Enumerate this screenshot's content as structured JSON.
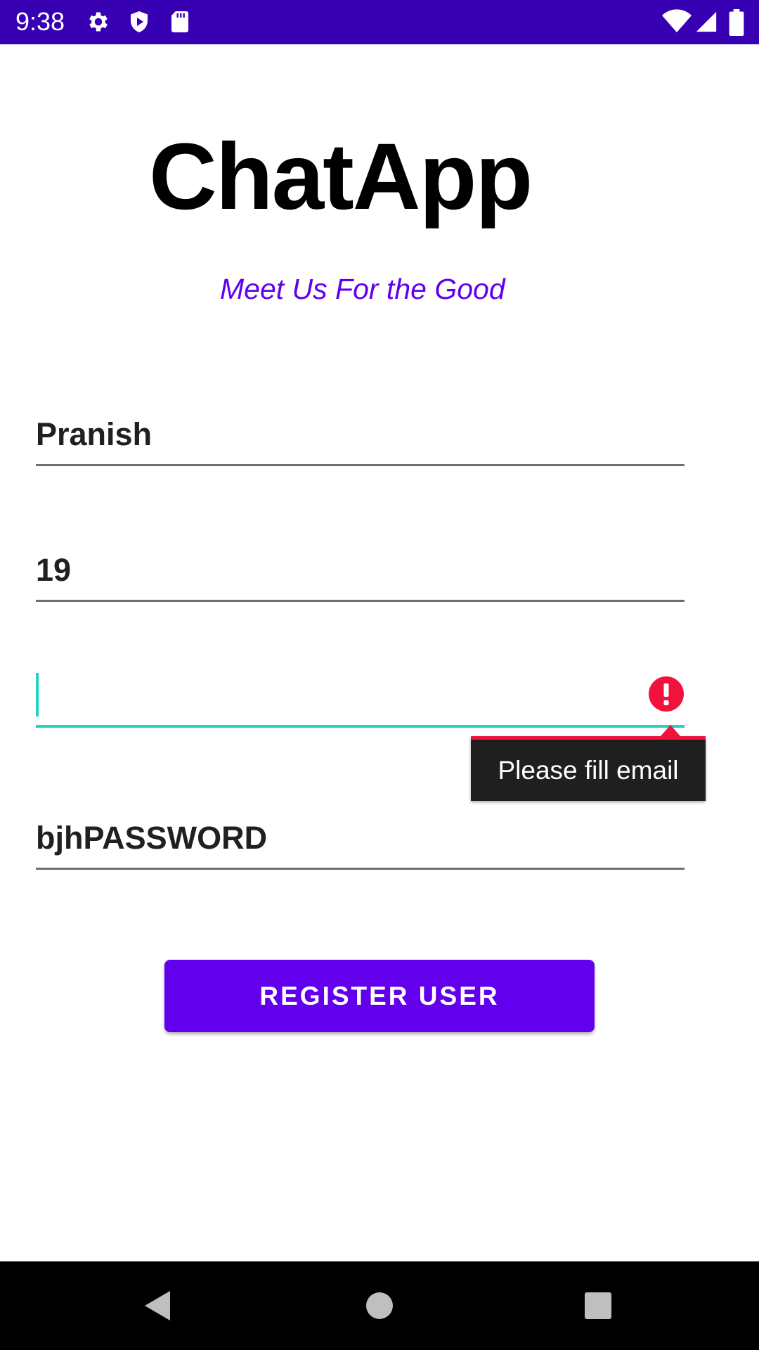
{
  "status_bar": {
    "time": "9:38",
    "left_icons": [
      "gear-icon",
      "shield-icon",
      "sd-card-icon"
    ],
    "right_icons": [
      "wifi-icon",
      "signal-icon",
      "battery-icon"
    ],
    "background": "#3700b3"
  },
  "header": {
    "title": "ChatApp",
    "subtitle": "Meet Us For the Good"
  },
  "form": {
    "name_value": "Pranish",
    "age_value": "19",
    "email_value": "",
    "password_value": "bjhPASSWORD",
    "email_error": "Please fill email"
  },
  "actions": {
    "register_label": "REGISTER USER"
  },
  "nav_bar": {
    "buttons": [
      "back-icon",
      "home-icon",
      "recents-icon"
    ]
  },
  "colors": {
    "primary": "#6200ee",
    "primary_dark": "#3700b3",
    "focus_accent": "#1ed4c8",
    "error": "#f0143c"
  }
}
